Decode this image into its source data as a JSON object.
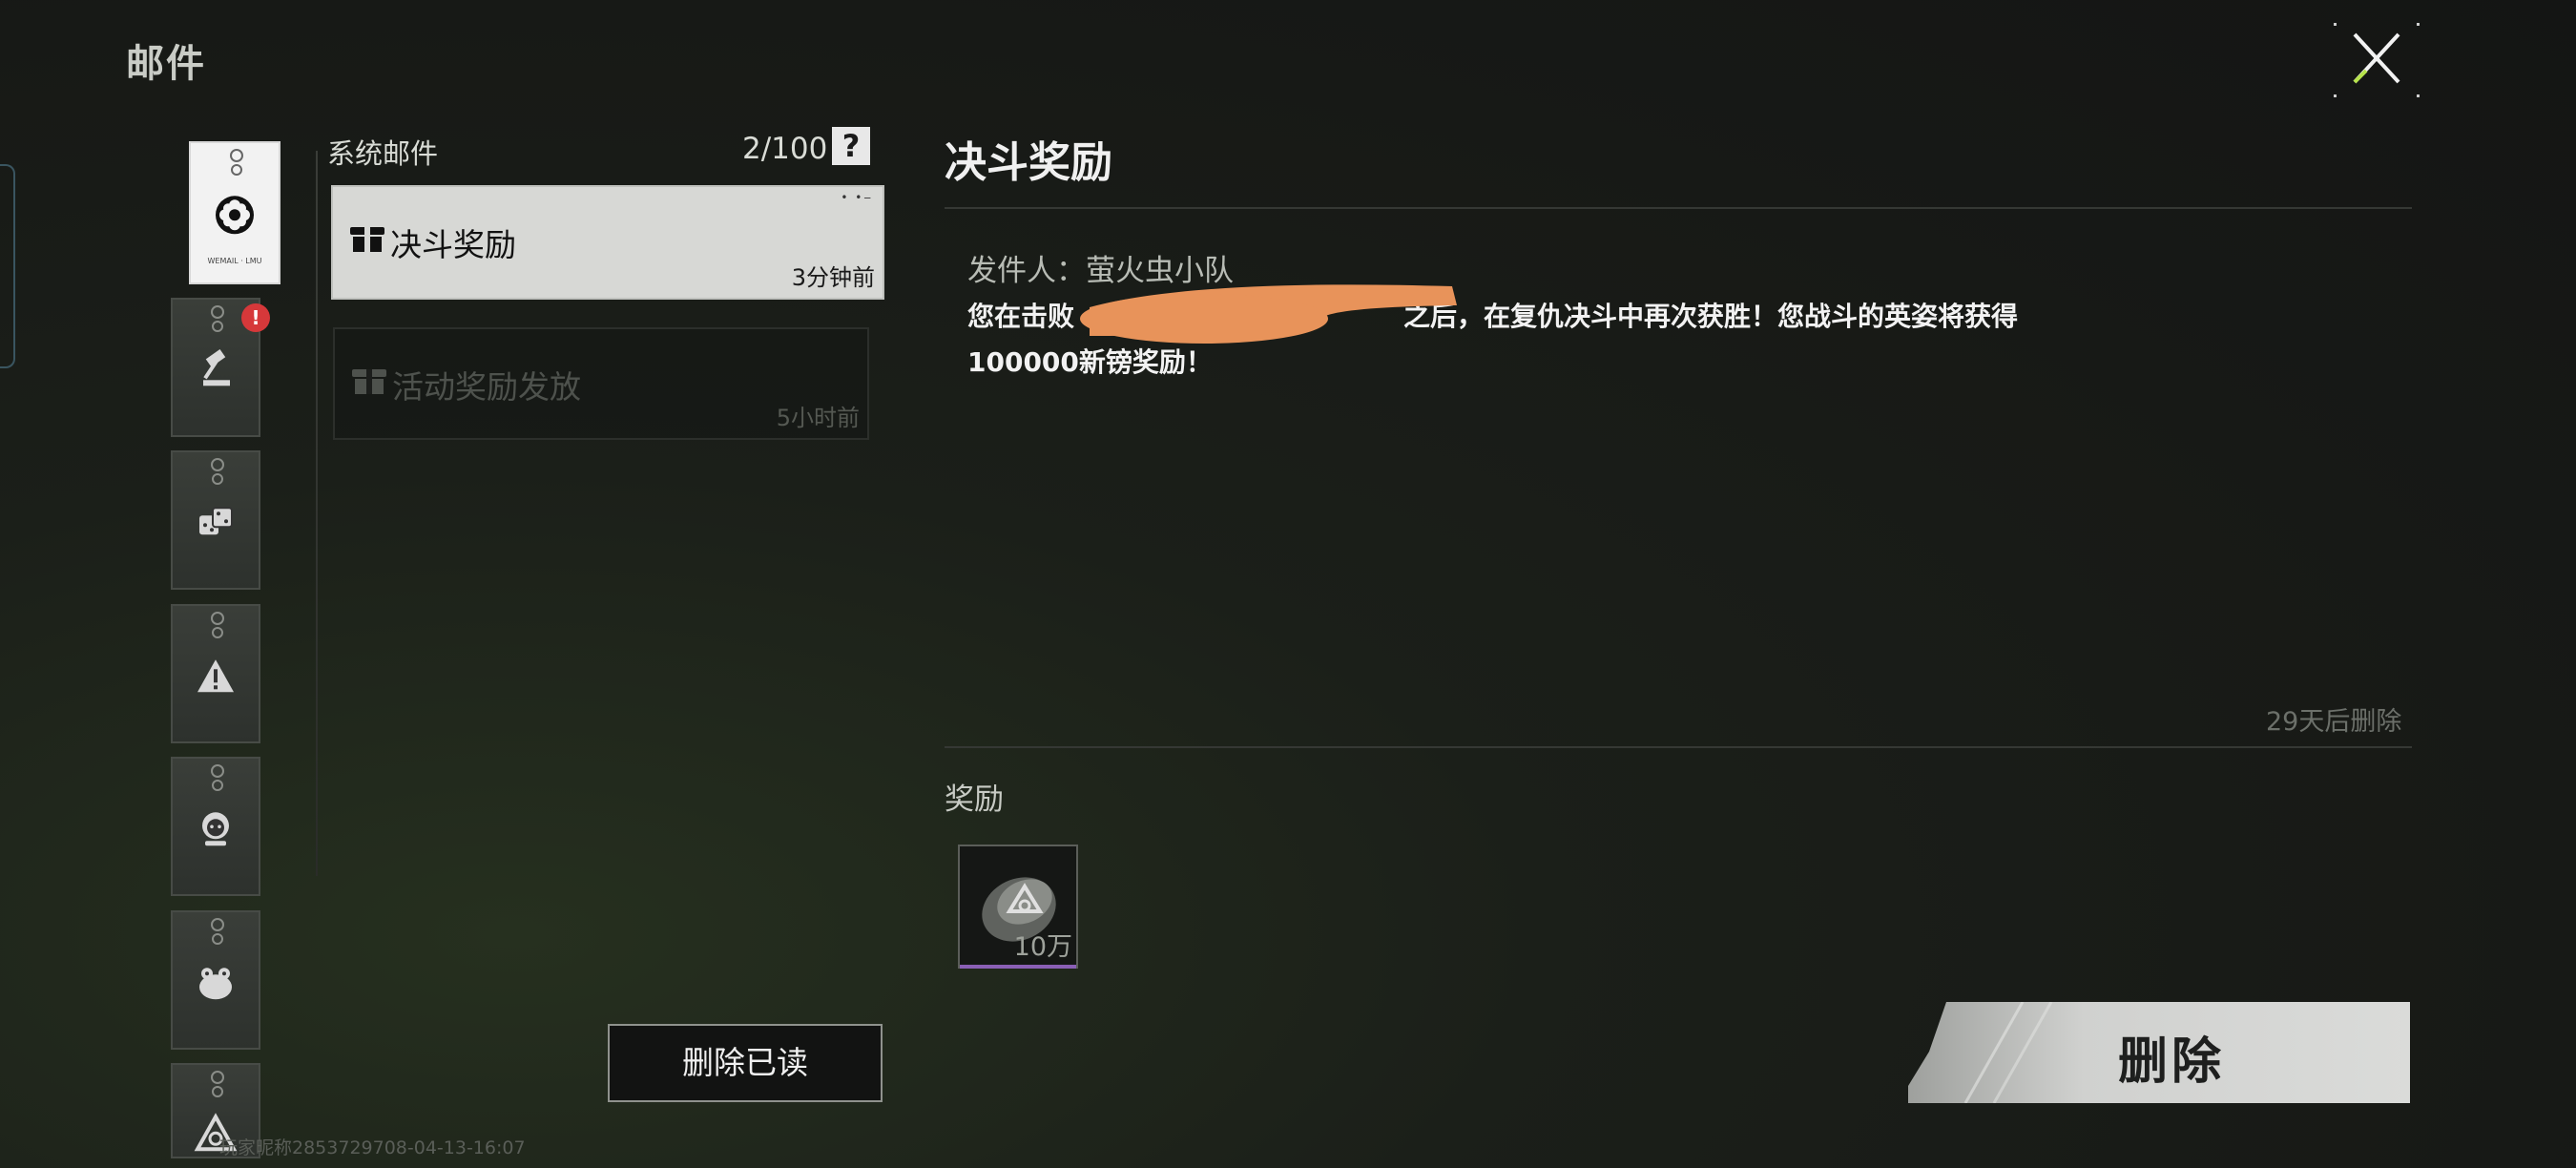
{
  "header": {
    "title": "邮件"
  },
  "colors": {
    "selected_bg": "#d7d8d5",
    "badge": "#d6383a",
    "rarity": "#8a5fb5",
    "redaction": "#e8935a"
  },
  "rail": {
    "items": [
      {
        "icon": "flower-icon",
        "active": true,
        "tiny": "WEMAIL · LMU"
      },
      {
        "icon": "gavel-icon",
        "active": false,
        "badge": "!"
      },
      {
        "icon": "dice-icon",
        "active": false
      },
      {
        "icon": "warning-icon",
        "active": false
      },
      {
        "icon": "avatar-icon",
        "active": false
      },
      {
        "icon": "frog-icon",
        "active": false
      },
      {
        "icon": "triangle-logo-icon",
        "active": false
      }
    ]
  },
  "mail_list": {
    "title": "系统邮件",
    "count": "2/100",
    "help": "?",
    "items": [
      {
        "title": "决斗奖励",
        "time": "3分钟前",
        "state": "selected"
      },
      {
        "title": "活动奖励发放",
        "time": "5小时前",
        "state": "read"
      }
    ],
    "delete_read_label": "删除已读"
  },
  "detail": {
    "title": "决斗奖励",
    "sender": "发件人：萤火虫小队",
    "body_line1": "您在击败",
    "body_line1_rest": "之后，在复仇决斗中再次获胜！您战斗的英姿将获得",
    "body_line2": "100000新镑奖励！",
    "expire": "29天后删除",
    "rewards_label": "奖励",
    "rewards": [
      {
        "icon": "currency-pouch-icon",
        "quantity": "10万"
      }
    ],
    "delete_label": "删除"
  },
  "footer": {
    "watermark": "玩家昵称2853729708-04-13-16:07"
  }
}
